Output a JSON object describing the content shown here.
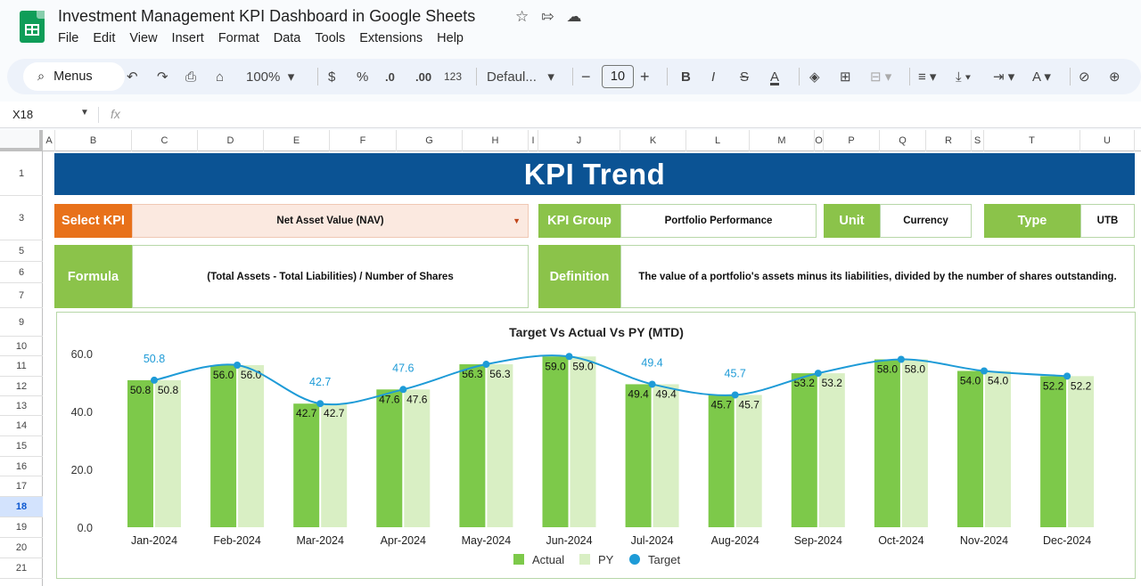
{
  "app": {
    "doc_title": "Investment Management KPI Dashboard in Google Sheets",
    "menu": [
      "File",
      "Edit",
      "View",
      "Insert",
      "Format",
      "Data",
      "Tools",
      "Extensions",
      "Help"
    ],
    "toolbar": {
      "menus_label": "Menus",
      "zoom": "100%",
      "currency": "$",
      "percent": "%",
      "dec_decrease": ".0",
      "dec_increase": ".00",
      "number_format": "123",
      "font": "Defaul...",
      "font_size": "10"
    },
    "name_box": "X18",
    "fx": "fx"
  },
  "columns": [
    "A",
    "B",
    "C",
    "D",
    "E",
    "F",
    "G",
    "H",
    "I",
    "J",
    "K",
    "L",
    "M",
    "O",
    "P",
    "Q",
    "R",
    "S",
    "T",
    "U"
  ],
  "rows": [
    "1",
    "3",
    "5",
    "6",
    "7",
    "9",
    "10",
    "11",
    "12",
    "13",
    "14",
    "15",
    "16",
    "17",
    "18",
    "19",
    "20",
    "21"
  ],
  "selected_row": "18",
  "dashboard": {
    "title": "KPI Trend",
    "select_kpi_label": "Select KPI",
    "select_kpi_value": "Net Asset Value (NAV)",
    "kpi_group_label": "KPI Group",
    "kpi_group_value": "Portfolio Performance",
    "unit_label": "Unit",
    "unit_value": "Currency",
    "type_label": "Type",
    "type_value": "UTB",
    "formula_label": "Formula",
    "formula_value": "(Total Assets - Total Liabilities) / Number of Shares",
    "definition_label": "Definition",
    "definition_value": "The value of a portfolio's assets minus its liabilities, divided by the number of shares outstanding."
  },
  "colors": {
    "banner": "#0b5394",
    "select_label": "#e8711a",
    "green_label": "#8bc34a",
    "actual": "#7dc94a",
    "py": "#d9efc4",
    "target": "#1e9bd7"
  },
  "chart_data": {
    "type": "bar",
    "title": "Target Vs Actual Vs PY (MTD)",
    "categories": [
      "Jan-2024",
      "Feb-2024",
      "Mar-2024",
      "Apr-2024",
      "May-2024",
      "Jun-2024",
      "Jul-2024",
      "Aug-2024",
      "Sep-2024",
      "Oct-2024",
      "Nov-2024",
      "Dec-2024"
    ],
    "series": [
      {
        "name": "Actual",
        "kind": "bar",
        "values": [
          50.8,
          56.0,
          42.7,
          47.6,
          56.3,
          59.0,
          49.4,
          45.7,
          53.2,
          58.0,
          54.0,
          52.2
        ]
      },
      {
        "name": "PY",
        "kind": "bar",
        "values": [
          50.8,
          56.0,
          42.7,
          47.6,
          56.3,
          59.0,
          49.4,
          45.7,
          53.2,
          58.0,
          54.0,
          52.2
        ]
      },
      {
        "name": "Target",
        "kind": "smooth-line",
        "values": [
          50.8,
          56.0,
          42.7,
          47.6,
          56.3,
          59.0,
          49.4,
          45.7,
          53.2,
          58.0,
          54.0,
          52.2
        ]
      }
    ],
    "target_labels_shown": [
      true,
      false,
      true,
      true,
      false,
      false,
      true,
      true,
      false,
      false,
      false,
      false
    ],
    "yticks": [
      "0.0",
      "20.0",
      "40.0",
      "60.0"
    ],
    "ylim": [
      0,
      60
    ],
    "legend_position": "bottom",
    "grid": false
  }
}
